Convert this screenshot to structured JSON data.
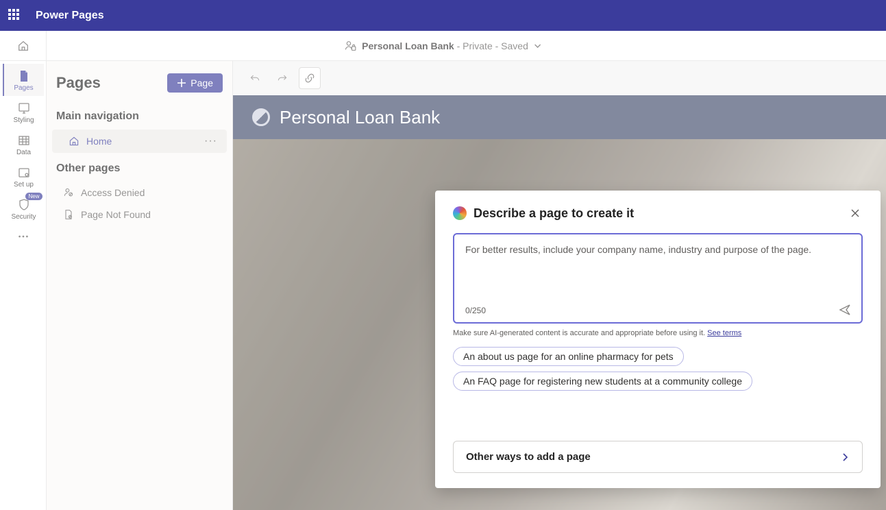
{
  "topbar": {
    "product_name": "Power Pages"
  },
  "subbar": {
    "site_name": "Personal Loan Bank",
    "status": "- Private - Saved"
  },
  "rail": {
    "items": [
      {
        "label": "Pages",
        "name": "pages",
        "active": true
      },
      {
        "label": "Styling",
        "name": "styling",
        "active": false
      },
      {
        "label": "Data",
        "name": "data",
        "active": false
      },
      {
        "label": "Set up",
        "name": "setup",
        "active": false
      },
      {
        "label": "Security",
        "name": "security",
        "active": false,
        "badge": "New"
      }
    ]
  },
  "left_panel": {
    "title": "Pages",
    "add_button": "Page",
    "section_main": "Main navigation",
    "main_items": [
      {
        "label": "Home",
        "selected": true
      }
    ],
    "section_other": "Other pages",
    "other_items": [
      {
        "label": "Access Denied",
        "icon": "access"
      },
      {
        "label": "Page Not Found",
        "icon": "notfound"
      }
    ]
  },
  "site": {
    "name": "Personal Loan Bank"
  },
  "dialog": {
    "title": "Describe a page to create it",
    "placeholder": "For better results, include your company name, industry and purpose of the page.",
    "char_count": "0/250",
    "disclaimer_text": "Make sure AI-generated content is accurate and appropriate before using it. ",
    "terms_link": "See terms",
    "suggestions": [
      "An about us page for an online pharmacy for pets",
      "An FAQ page for registering new students at a community college"
    ],
    "other_ways": "Other ways to add a page"
  }
}
